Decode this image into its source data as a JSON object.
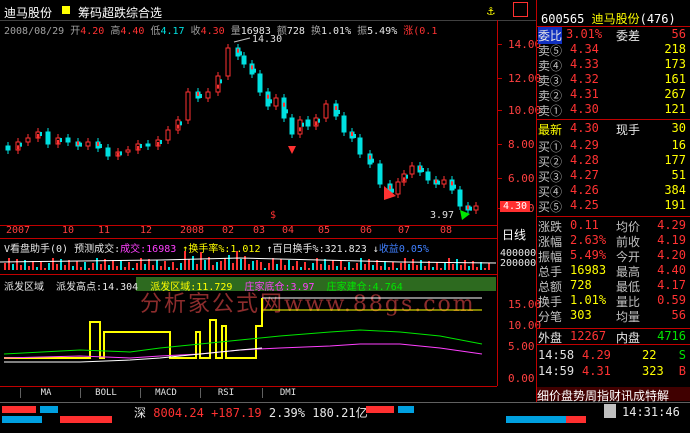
{
  "header": {
    "stock_name": "迪马股份",
    "indicator": "筹码超跌综合选",
    "date": "2008/08/29",
    "open_label": "开",
    "open": "4.20",
    "high_label": "高",
    "high": "4.40",
    "low_label": "低",
    "low": "4.17",
    "close_label": "收",
    "close": "4.30",
    "vol_label": "量",
    "vol": "16983",
    "amt_label": "额",
    "amt": "728",
    "turn_label": "换",
    "turn": "1.01%",
    "amp_label": "振",
    "amp": "5.49%",
    "chg_label": "涨",
    "chg": "(0.1"
  },
  "price_axis": [
    "14.00",
    "12.00",
    "10.00",
    "8.00",
    "6.00",
    "4.00"
  ],
  "price_marks": {
    "high": "14.30",
    "low": "3.97",
    "last": "4.30"
  },
  "time_axis": [
    "2007",
    "10",
    "11",
    "12",
    "2008",
    "02",
    "03",
    "04",
    "05",
    "06",
    "07",
    "08"
  ],
  "day_line_btn": "日线",
  "vol_panel": {
    "title": "V看盘助手(0) 预测成交:",
    "cj_label": "成交:",
    "cj": "16983",
    "turn_label": "换手率%:",
    "turn": "1.012",
    "bai_label": "百日换手%:",
    "bai": "321.823",
    "shouyi_label": "收益",
    "shouyi": "0.05%",
    "axis": [
      "400000",
      "200000"
    ]
  },
  "pf_panel": {
    "title": "派发区域",
    "gd_label": "派发高点:",
    "gd": "14.304",
    "qy_label": "派发区域:",
    "qy": "11.729",
    "dc_label": "庄家底仓:",
    "dc": "3.97",
    "jc_label": "庄家建仓:",
    "jc": "4.764",
    "watermark": "分析家公式网www.88gs.com",
    "axis": [
      "15.00",
      "10.00",
      "5.00",
      "0.00"
    ]
  },
  "tabs": [
    "MA",
    "BOLL",
    "MACD",
    "RSI",
    "DMI"
  ],
  "quote": {
    "code": "600565",
    "name": "迪马股份",
    "num": "(476)",
    "webi_label": "委比",
    "webi": "3.01%",
    "wecha_label": "委差",
    "wecha": "56",
    "asks": [
      {
        "label": "卖⑤",
        "price": "4.34",
        "vol": "218"
      },
      {
        "label": "卖④",
        "price": "4.33",
        "vol": "173"
      },
      {
        "label": "卖③",
        "price": "4.32",
        "vol": "161"
      },
      {
        "label": "卖②",
        "price": "4.31",
        "vol": "267"
      },
      {
        "label": "卖①",
        "price": "4.30",
        "vol": "121"
      }
    ],
    "last_label": "最新",
    "last": "4.30",
    "xs_label": "现手",
    "xs": "30",
    "bids": [
      {
        "label": "买①",
        "price": "4.29",
        "vol": "16"
      },
      {
        "label": "买②",
        "price": "4.28",
        "vol": "177"
      },
      {
        "label": "买③",
        "price": "4.27",
        "vol": "51"
      },
      {
        "label": "买④",
        "price": "4.26",
        "vol": "384"
      },
      {
        "label": "买⑤",
        "price": "4.25",
        "vol": "191"
      }
    ],
    "stats": [
      {
        "l1": "涨跌",
        "v1": "0.11",
        "l2": "均价",
        "v2": "4.29"
      },
      {
        "l1": "涨幅",
        "v1": "2.63%",
        "l2": "前收",
        "v2": "4.19"
      },
      {
        "l1": "振幅",
        "v1": "5.49%",
        "l2": "今开",
        "v2": "4.20"
      },
      {
        "l1": "总手",
        "v1": "16983",
        "l2": "最高",
        "v2": "4.40"
      },
      {
        "l1": "总额",
        "v1": "728",
        "l2": "最低",
        "v2": "4.17"
      },
      {
        "l1": "换手",
        "v1": "1.01%",
        "l2": "量比",
        "v2": "0.59"
      },
      {
        "l1": "分笔",
        "v1": "303",
        "l2": "均量",
        "v2": "56"
      }
    ],
    "outer_label": "外盘",
    "outer": "12267",
    "inner_label": "内盘",
    "inner": "4716",
    "ticks": [
      {
        "time": "14:58",
        "price": "4.29",
        "vol": "22",
        "flag": "S"
      },
      {
        "time": "14:59",
        "price": "4.31",
        "vol": "323",
        "flag": "B"
      }
    ],
    "bottom_tabs": "细价盘势周指财讯成特解"
  },
  "status": {
    "index_label": "深",
    "index": "8004.24",
    "chg": "+187.19",
    "pct": "2.39%",
    "amt": "180.21亿",
    "time": "14:31:46"
  }
}
